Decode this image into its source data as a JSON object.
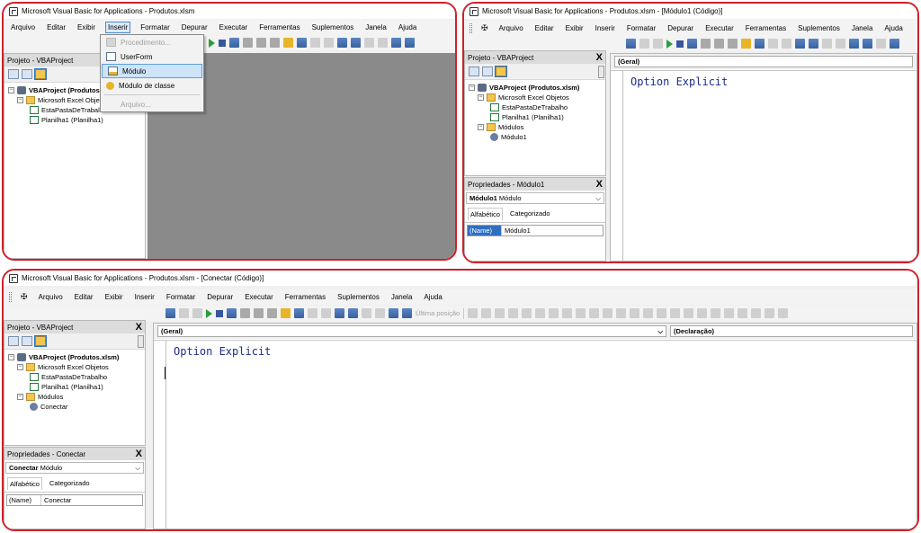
{
  "colors": {
    "highlight_border": "#d0202a",
    "code_text": "#1c2d8c",
    "selection": "#2f6ec0"
  },
  "panel1": {
    "title": "Microsoft Visual Basic for Applications - Produtos.xlsm",
    "menus": [
      "Arquivo",
      "Editar",
      "Exibir",
      "Inserir",
      "Formatar",
      "Depurar",
      "Executar",
      "Ferramentas",
      "Suplementos",
      "Janela",
      "Ajuda"
    ],
    "active_menu": "Inserir",
    "insert_menu": {
      "items": [
        {
          "label": "Procedimento...",
          "icon": "procedure-icon",
          "enabled": false
        },
        {
          "label": "UserForm",
          "icon": "userform-icon",
          "enabled": true
        },
        {
          "label": "Módulo",
          "icon": "module-icon",
          "enabled": true,
          "highlighted": true
        },
        {
          "label": "Módulo de classe",
          "icon": "class-module-icon",
          "enabled": true
        },
        {
          "label": "Arquivo...",
          "icon": "file-icon",
          "enabled": false
        }
      ]
    },
    "project": {
      "title": "Projeto - VBAProject",
      "tree": {
        "root": "VBAProject (Produtos",
        "folder": "Microsoft Excel Objet",
        "items": [
          "EstaPastaDeTrabalho",
          "Planilha1 (Planilha1)"
        ]
      }
    }
  },
  "panel2": {
    "title": "Microsoft Visual Basic for Applications - Produtos.xlsm - [Módulo1 (Código)]",
    "menus": [
      "Arquivo",
      "Editar",
      "Exibir",
      "Inserir",
      "Formatar",
      "Depurar",
      "Executar",
      "Ferramentas",
      "Suplementos",
      "Janela",
      "Ajuda"
    ],
    "project": {
      "title": "Projeto - VBAProject",
      "close": "X",
      "tree": {
        "root": "VBAProject (Produtos.xlsm)",
        "folder": "Microsoft Excel Objetos",
        "items": [
          "EstaPastaDeTrabalho",
          "Planilha1 (Planilha1)"
        ],
        "modules_folder": "Módulos",
        "modules": [
          "Módulo1"
        ]
      }
    },
    "properties": {
      "title": "Propriedades - Módulo1",
      "close": "X",
      "object_name": "Módulo1",
      "object_type": "Módulo",
      "tabs": [
        "Alfabético",
        "Categorizado"
      ],
      "rows": [
        {
          "key": "(Name)",
          "value": "Módulo1"
        }
      ]
    },
    "code": {
      "object_combo": "(Geral)",
      "text": "Option Explicit"
    }
  },
  "panel3": {
    "title": "Microsoft Visual Basic for Applications - Produtos.xlsm - [Conectar (Código)]",
    "menus": [
      "Arquivo",
      "Editar",
      "Exibir",
      "Inserir",
      "Formatar",
      "Depurar",
      "Executar",
      "Ferramentas",
      "Suplementos",
      "Janela",
      "Ajuda"
    ],
    "toolbar_disabled_label": "Última posição",
    "project": {
      "title": "Projeto - VBAProject",
      "close": "X",
      "tree": {
        "root": "VBAProject (Produtos.xlsm)",
        "folder": "Microsoft Excel Objetos",
        "items": [
          "EstaPastaDeTrabalho",
          "Planilha1 (Planilha1)"
        ],
        "modules_folder": "Módulos",
        "modules": [
          "Conectar"
        ]
      }
    },
    "properties": {
      "title": "Propriedades - Conectar",
      "close": "X",
      "object_name": "Conectar",
      "object_type": "Módulo",
      "tabs": [
        "Alfabético",
        "Categorizado"
      ],
      "rows": [
        {
          "key": "(Name)",
          "value": "Conectar"
        }
      ]
    },
    "code": {
      "object_combo": "(Geral)",
      "proc_combo": "(Declaração)",
      "text": "Option Explicit"
    }
  }
}
